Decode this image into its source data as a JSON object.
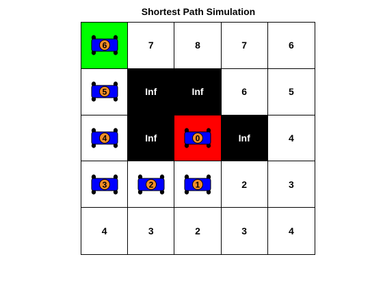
{
  "title": "Shortest Path Simulation",
  "colors": {
    "wall": "#000000",
    "start": "#ff0000",
    "goal": "#00ff00",
    "free": "#ffffff",
    "car_body": "#0000ff",
    "car_badge": "#f28c28"
  },
  "grid": [
    [
      {
        "type": "goal",
        "car": "6"
      },
      {
        "type": "free",
        "text": "7"
      },
      {
        "type": "free",
        "text": "8"
      },
      {
        "type": "free",
        "text": "7"
      },
      {
        "type": "free",
        "text": "6"
      }
    ],
    [
      {
        "type": "free",
        "car": "5"
      },
      {
        "type": "wall",
        "text": "Inf"
      },
      {
        "type": "wall",
        "text": "Inf"
      },
      {
        "type": "free",
        "text": "6"
      },
      {
        "type": "free",
        "text": "5"
      }
    ],
    [
      {
        "type": "free",
        "car": "4"
      },
      {
        "type": "wall",
        "text": "Inf"
      },
      {
        "type": "start",
        "car": "0"
      },
      {
        "type": "wall",
        "text": "Inf"
      },
      {
        "type": "free",
        "text": "4"
      }
    ],
    [
      {
        "type": "free",
        "car": "3"
      },
      {
        "type": "free",
        "car": "2"
      },
      {
        "type": "free",
        "car": "1"
      },
      {
        "type": "free",
        "text": "2"
      },
      {
        "type": "free",
        "text": "3"
      }
    ],
    [
      {
        "type": "free",
        "text": "4"
      },
      {
        "type": "free",
        "text": "3"
      },
      {
        "type": "free",
        "text": "2"
      },
      {
        "type": "free",
        "text": "3"
      },
      {
        "type": "free",
        "text": "4"
      }
    ]
  ]
}
